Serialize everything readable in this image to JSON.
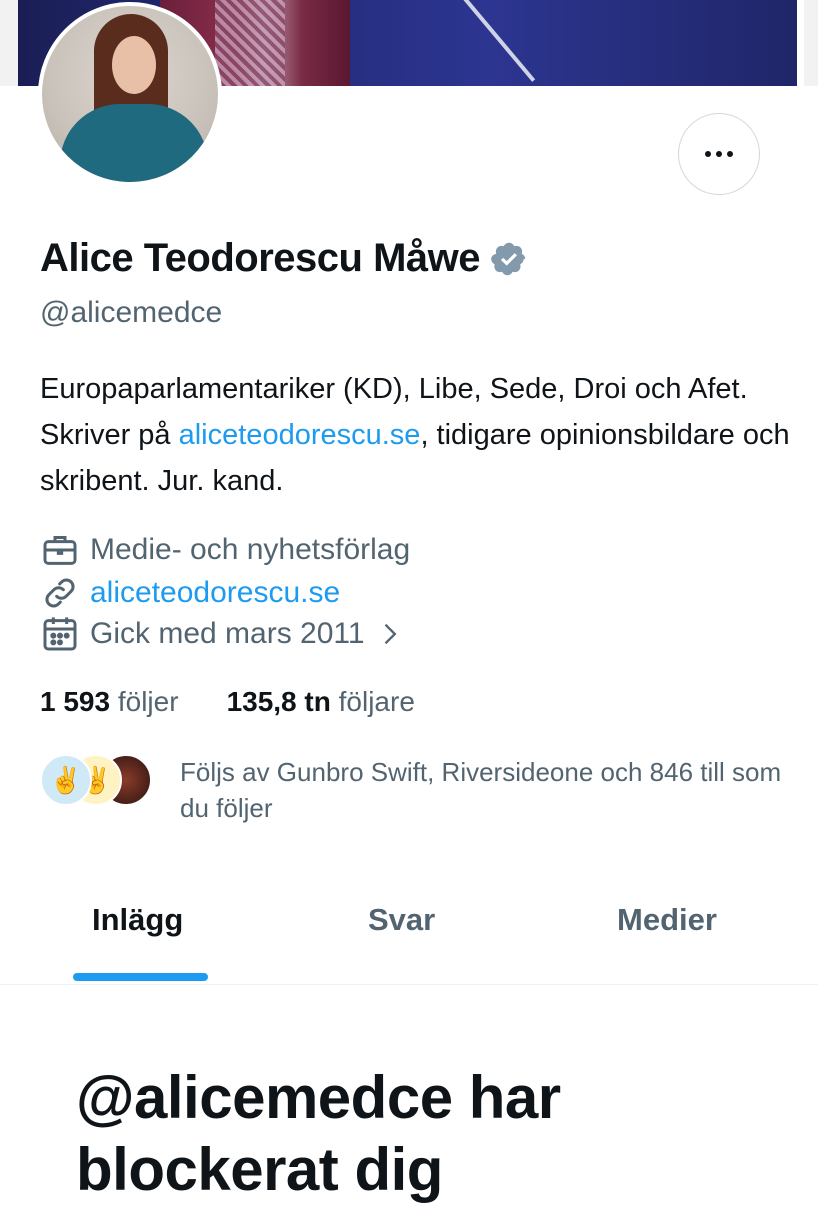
{
  "profile": {
    "name": "Alice Teodorescu Måwe",
    "handle": "@alicemedce",
    "bio": {
      "part1": "Europaparlamentariker (KD), Libe, Sede, Droi och Afet. Skriver på ",
      "link": "aliceteodorescu.se",
      "part2": ", tidigare opinionsbildare och skribent. Jur. kand."
    },
    "category": "Medie- och nyhetsförlag",
    "website": "aliceteodorescu.se",
    "joined": "Gick med mars 2011"
  },
  "stats": {
    "following_count": "1 593",
    "following_label": "följer",
    "followers_count": "135,8 tn",
    "followers_label": "följare"
  },
  "followed_by": {
    "text": "Följs av Gunbro Swift, Riversideone och 846 till som du följer",
    "avatars": [
      "✌️",
      "✌️",
      ""
    ]
  },
  "tabs": [
    {
      "label": "Inlägg",
      "active": true
    },
    {
      "label": "Svar",
      "active": false
    },
    {
      "label": "Medier",
      "active": false
    }
  ],
  "blocked_message": "@alicemedce har blockerat dig",
  "colors": {
    "accent": "#1d9bf0",
    "verified_badge": "#829aab",
    "secondary_text": "#536471"
  },
  "icons": {
    "more": "more-horizontal-icon",
    "verified": "verified-badge-icon",
    "briefcase": "briefcase-icon",
    "link": "link-icon",
    "calendar": "calendar-icon",
    "chevron": "chevron-right-icon"
  }
}
